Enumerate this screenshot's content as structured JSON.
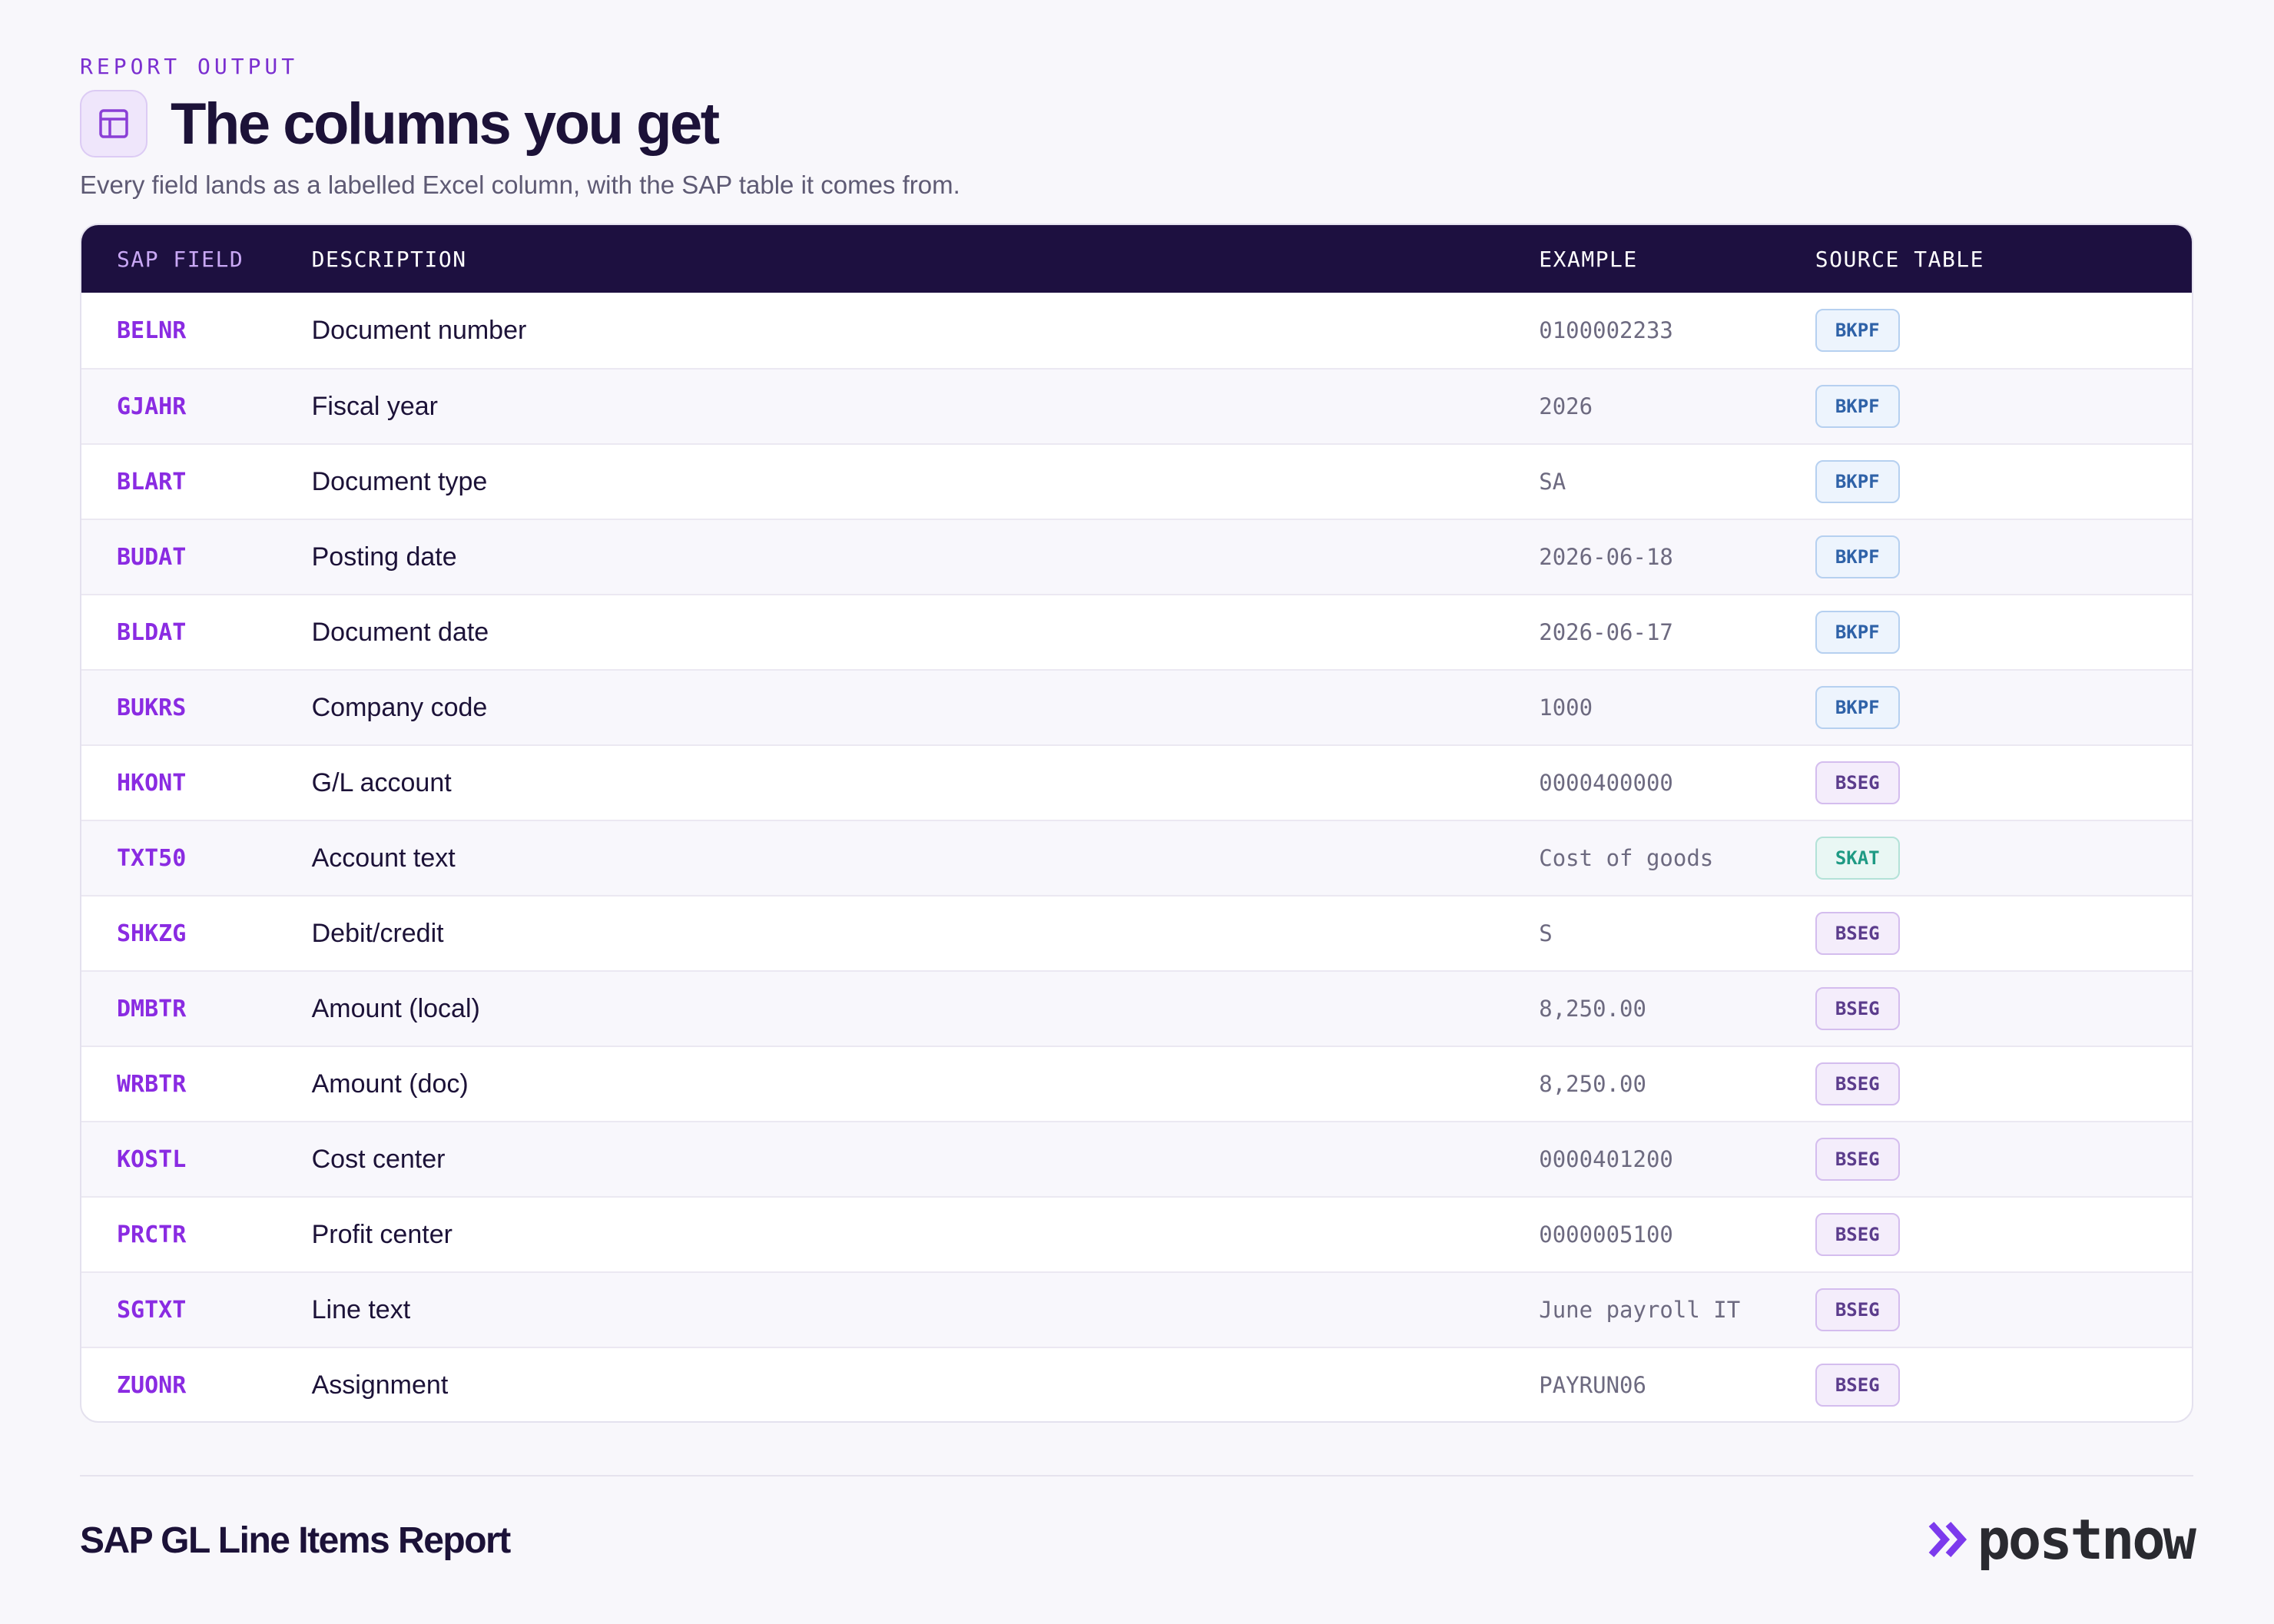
{
  "header": {
    "eyebrow": "REPORT OUTPUT",
    "title": "The columns you get",
    "subtitle": "Every field lands as a labelled Excel column, with the SAP table it comes from.",
    "icon": "table-icon"
  },
  "table": {
    "columns": [
      "SAP FIELD",
      "DESCRIPTION",
      "EXAMPLE",
      "SOURCE TABLE"
    ],
    "rows": [
      {
        "field": "BELNR",
        "description": "Document number",
        "example": "0100002233",
        "source": "BKPF"
      },
      {
        "field": "GJAHR",
        "description": "Fiscal year",
        "example": "2026",
        "source": "BKPF"
      },
      {
        "field": "BLART",
        "description": "Document type",
        "example": "SA",
        "source": "BKPF"
      },
      {
        "field": "BUDAT",
        "description": "Posting date",
        "example": "2026-06-18",
        "source": "BKPF"
      },
      {
        "field": "BLDAT",
        "description": "Document date",
        "example": "2026-06-17",
        "source": "BKPF"
      },
      {
        "field": "BUKRS",
        "description": "Company code",
        "example": "1000",
        "source": "BKPF"
      },
      {
        "field": "HKONT",
        "description": "G/L account",
        "example": "0000400000",
        "source": "BSEG"
      },
      {
        "field": "TXT50",
        "description": "Account text",
        "example": "Cost of goods",
        "source": "SKAT"
      },
      {
        "field": "SHKZG",
        "description": "Debit/credit",
        "example": "S",
        "source": "BSEG"
      },
      {
        "field": "DMBTR",
        "description": "Amount (local)",
        "example": "8,250.00",
        "source": "BSEG"
      },
      {
        "field": "WRBTR",
        "description": "Amount (doc)",
        "example": "8,250.00",
        "source": "BSEG"
      },
      {
        "field": "KOSTL",
        "description": "Cost center",
        "example": "0000401200",
        "source": "BSEG"
      },
      {
        "field": "PRCTR",
        "description": "Profit center",
        "example": "0000005100",
        "source": "BSEG"
      },
      {
        "field": "SGTXT",
        "description": "Line text",
        "example": "June payroll IT",
        "source": "BSEG"
      },
      {
        "field": "ZUONR",
        "description": "Assignment",
        "example": "PAYRUN06",
        "source": "BSEG"
      }
    ],
    "source_colors": {
      "BKPF": "#2f62a8",
      "BSEG": "#5b3c8c",
      "SKAT": "#1e9a84"
    }
  },
  "footer": {
    "report_name": "SAP GL Line Items Report",
    "brand": "postnow",
    "brand_icon": "double-chevron-right-icon",
    "brand_accent": "#7c3aed"
  }
}
